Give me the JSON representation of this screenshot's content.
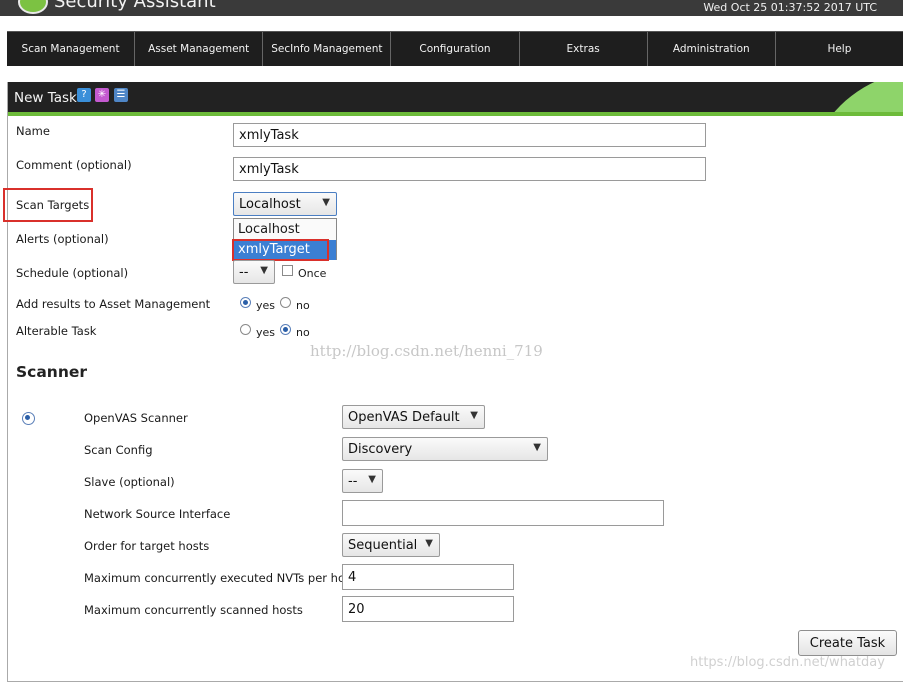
{
  "header": {
    "app_title": "Security Assistant",
    "datetime": "Wed Oct 25 01:37:52 2017 UTC"
  },
  "nav": [
    {
      "label": "Scan Management"
    },
    {
      "label": "Asset Management"
    },
    {
      "label": "SecInfo Management"
    },
    {
      "label": "Configuration"
    },
    {
      "label": "Extras"
    },
    {
      "label": "Administration"
    },
    {
      "label": "Help"
    }
  ],
  "panel": {
    "title": "New Task",
    "icons": [
      "help-icon",
      "new-icon",
      "list-icon"
    ]
  },
  "form": {
    "name": {
      "label": "Name",
      "value": "xmlyTask"
    },
    "comment": {
      "label": "Comment (optional)",
      "value": "xmlyTask"
    },
    "scan_targets": {
      "label": "Scan Targets",
      "selected": "Localhost",
      "options": [
        "Localhost",
        "xmlyTarget"
      ],
      "highlighted_option": "xmlyTarget"
    },
    "alerts": {
      "label": "Alerts (optional)"
    },
    "schedule": {
      "label": "Schedule (optional)",
      "selected": "--",
      "once_label": "Once",
      "once_checked": false
    },
    "add_results": {
      "label": "Add results to Asset Management",
      "yes": "yes",
      "no": "no",
      "value": "yes"
    },
    "alterable": {
      "label": "Alterable Task",
      "yes": "yes",
      "no": "no",
      "value": "no"
    }
  },
  "scanner": {
    "section_title": "Scanner",
    "scanner_name": "OpenVAS Scanner",
    "scanner_selected": "OpenVAS Default",
    "scan_config": {
      "label": "Scan Config",
      "selected": "Discovery"
    },
    "slave": {
      "label": "Slave (optional)",
      "selected": "--"
    },
    "network_source": {
      "label": "Network Source Interface",
      "value": ""
    },
    "order": {
      "label": "Order for target hosts",
      "selected": "Sequential"
    },
    "max_nvts": {
      "label": "Maximum concurrently executed NVTs per host",
      "value": "4"
    },
    "max_hosts": {
      "label": "Maximum concurrently scanned hosts",
      "value": "20"
    }
  },
  "actions": {
    "create_label": "Create Task"
  },
  "watermarks": {
    "center": "http://blog.csdn.net/henni_719",
    "bottom": "https://blog.csdn.net/whatday"
  },
  "colors": {
    "accent_green": "#6dbb3a",
    "highlight_red": "#d9302b",
    "selection_blue": "#3b7fd3"
  }
}
